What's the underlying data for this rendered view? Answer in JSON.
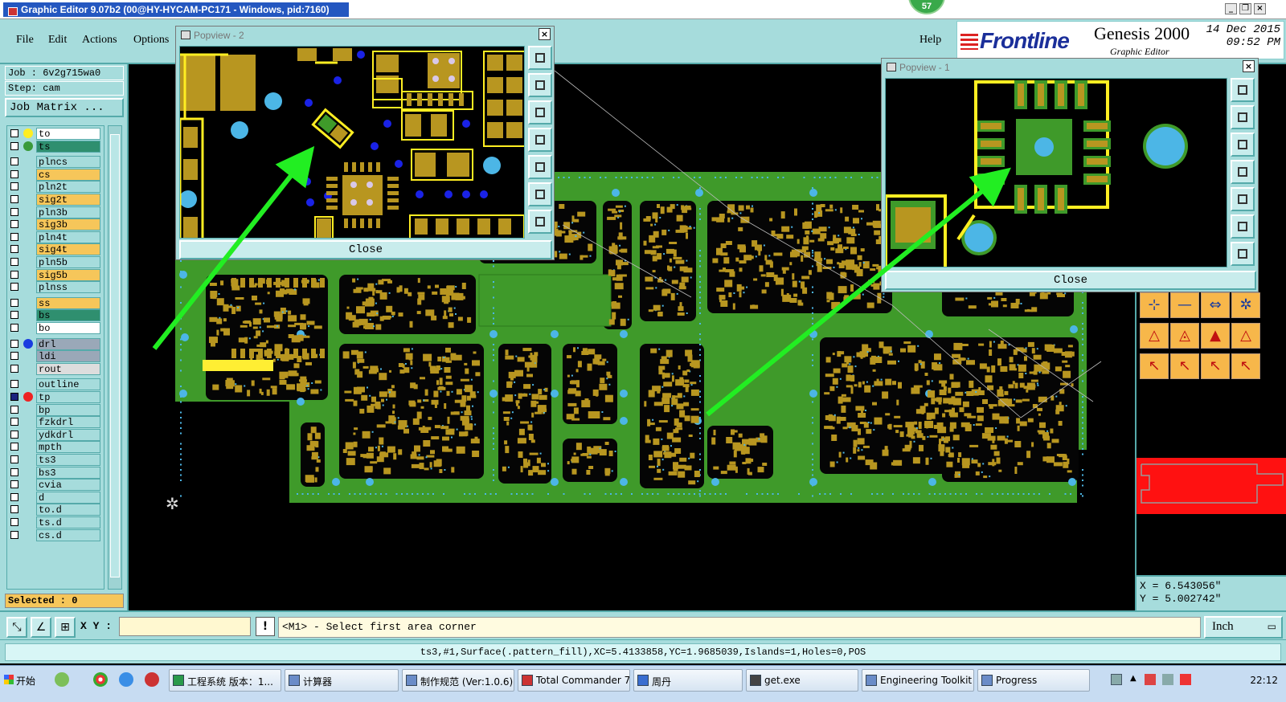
{
  "window": {
    "title": "Graphic Editor 9.07b2 (00@HY-HYCAM-PC171 - Windows, pid:7160)",
    "badge": "57"
  },
  "menu": {
    "file": "File",
    "edit": "Edit",
    "actions": "Actions",
    "options": "Options",
    "help": "Help"
  },
  "brand": {
    "logo": "Frontline",
    "product": "Genesis 2000",
    "subtitle": "Graphic Editor",
    "date": "14 Dec 2015",
    "time": "09:52 PM"
  },
  "job": {
    "job_line": "Job : 6v2g715wa0",
    "step_line": "Step: cam",
    "matrix_button": "Job Matrix ...",
    "selected": "Selected : 0"
  },
  "layers": [
    {
      "name": "to",
      "bg": "#ffffff",
      "dot": "#ffee22"
    },
    {
      "name": "ts",
      "bg": "#2f8f6f",
      "dot": "#3a9a3a"
    },
    {
      "name": "plncs",
      "bg": "#a6dcdc",
      "dot": ""
    },
    {
      "name": "cs",
      "bg": "#f6c65a",
      "dot": ""
    },
    {
      "name": "pln2t",
      "bg": "#a6dcdc",
      "dot": ""
    },
    {
      "name": "sig2t",
      "bg": "#f6c65a",
      "dot": ""
    },
    {
      "name": "pln3b",
      "bg": "#a6dcdc",
      "dot": ""
    },
    {
      "name": "sig3b",
      "bg": "#f6c65a",
      "dot": ""
    },
    {
      "name": "pln4t",
      "bg": "#a6dcdc",
      "dot": ""
    },
    {
      "name": "sig4t",
      "bg": "#f6c65a",
      "dot": ""
    },
    {
      "name": "pln5b",
      "bg": "#a6dcdc",
      "dot": ""
    },
    {
      "name": "sig5b",
      "bg": "#f6c65a",
      "dot": ""
    },
    {
      "name": "plnss",
      "bg": "#a6dcdc",
      "dot": ""
    },
    {
      "name": "ss",
      "bg": "#f6c65a",
      "dot": ""
    },
    {
      "name": "bs",
      "bg": "#2f8f6f",
      "dot": ""
    },
    {
      "name": "bo",
      "bg": "#ffffff",
      "dot": ""
    },
    {
      "name": "drl",
      "bg": "#9aa8b8",
      "dot": "#1a3de0"
    },
    {
      "name": "ldi",
      "bg": "#9aa8b8",
      "dot": ""
    },
    {
      "name": "rout",
      "bg": "#dddddd",
      "dot": ""
    },
    {
      "name": "outline",
      "bg": "#a6dcdc",
      "dot": ""
    },
    {
      "name": "tp",
      "bg": "#a6dcdc",
      "dot": "#ee2222"
    },
    {
      "name": "bp",
      "bg": "#a6dcdc",
      "dot": ""
    },
    {
      "name": "fzkdrl",
      "bg": "#a6dcdc",
      "dot": ""
    },
    {
      "name": "ydkdrl",
      "bg": "#a6dcdc",
      "dot": ""
    },
    {
      "name": "mpth",
      "bg": "#a6dcdc",
      "dot": ""
    },
    {
      "name": "ts3",
      "bg": "#a6dcdc",
      "dot": ""
    },
    {
      "name": "bs3",
      "bg": "#a6dcdc",
      "dot": ""
    },
    {
      "name": "cvia",
      "bg": "#a6dcdc",
      "dot": ""
    },
    {
      "name": "d",
      "bg": "#a6dcdc",
      "dot": ""
    },
    {
      "name": "to.d",
      "bg": "#a6dcdc",
      "dot": ""
    },
    {
      "name": "ts.d",
      "bg": "#a6dcdc",
      "dot": ""
    },
    {
      "name": "cs.d",
      "bg": "#a6dcdc",
      "dot": ""
    }
  ],
  "popview2": {
    "title": "Popview - 2",
    "close": "Close"
  },
  "popview1": {
    "title": "Popview - 1",
    "close": "Close"
  },
  "coords": {
    "x": "X = 6.543056\"",
    "y": "Y = 5.002742\""
  },
  "command": {
    "xy_label": "X Y :",
    "xy_value": "",
    "bang": "!",
    "prompt": "<M1> - Select first area corner",
    "unit": "Inch"
  },
  "status": "ts3,#1,Surface(.pattern_fill),XC=5.4133858,YC=1.9685039,Islands=1,Holes=0,POS",
  "taskbar": {
    "start": "开始",
    "tasks": [
      "工程系统 版本：1...",
      "计算器",
      "制作规范 (Ver:1.0.6)",
      "Total Commander 7.0...",
      "周丹",
      "get.exe",
      "Engineering Toolkit 9....",
      "Progress"
    ],
    "clock": "22:12"
  },
  "colors": {
    "board_green": "#3f9a2a",
    "copper": "#b89620",
    "via_blue": "#4cb6e6",
    "panel_cyan": "#a6dcdc",
    "arrow_green": "#22ee22"
  }
}
